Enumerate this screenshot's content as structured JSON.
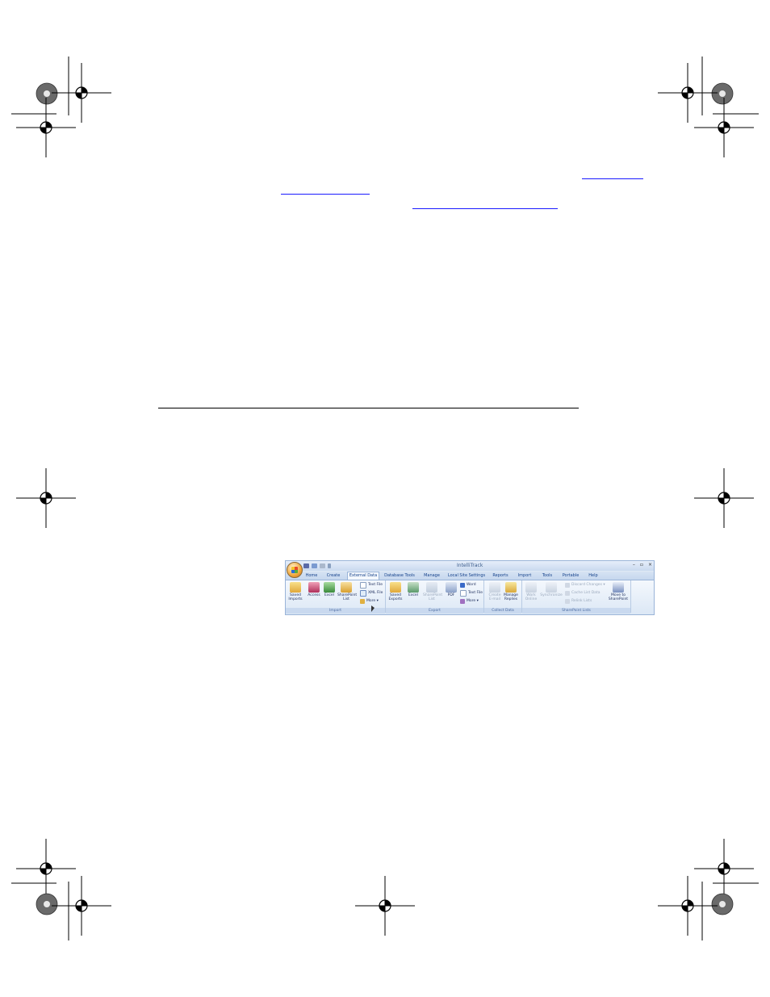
{
  "ribbon": {
    "app_title": "IntelliTrack",
    "window_controls": [
      "–",
      "▫",
      "×"
    ],
    "tabs": [
      "Home",
      "Create",
      "External Data",
      "Database Tools",
      "Manage",
      "Local Site Settings",
      "Reports",
      "Import",
      "Tools",
      "Portable",
      "Help"
    ],
    "active_tab": "External Data",
    "groups": {
      "import": {
        "label": "Import",
        "saved_imports": [
          "Saved",
          "Imports"
        ],
        "access": "Access",
        "excel": "Excel",
        "sharepoint": [
          "SharePoint",
          "List"
        ],
        "text_file": "Text File",
        "xml_file": "XML File",
        "more": "More ▾"
      },
      "export": {
        "label": "Export",
        "saved_exports": [
          "Saved",
          "Exports"
        ],
        "excel": "Excel",
        "sharepoint": [
          "SharePoint",
          "List"
        ],
        "pdf": "PDF",
        "word": "Word",
        "text_file": "Text File",
        "more": "More ▾"
      },
      "collect": {
        "label": "Collect Data",
        "create_email": [
          "Create",
          "E-mail"
        ],
        "manage_replies": [
          "Manage",
          "Replies"
        ]
      },
      "sharepoint_lists": {
        "label": "SharePoint Lists",
        "work_online": [
          "Work",
          "Online"
        ],
        "synchronize": "Synchronize",
        "discard_changes": "Discard Changes ▾",
        "cache_list_data": "Cache List Data",
        "relink_lists": "Relink Lists",
        "move_to_sharepoint": [
          "Move to",
          "SharePoint"
        ]
      }
    }
  }
}
